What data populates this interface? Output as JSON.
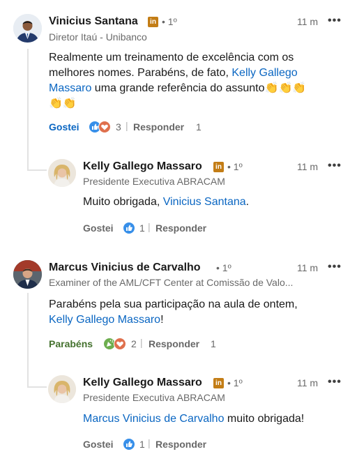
{
  "comments": [
    {
      "author": "Vinicius Santana",
      "badge": "in",
      "degree": "• 1º",
      "headline": "Diretor Itaú - Unibanco",
      "time": "11 m",
      "more": "•••",
      "text_line1": "Realmente um treinamento de excelência com os",
      "text_line2_pre": "melhores nomes.  Parabéns,  de fato, ",
      "text_line2_mention": "Kelly Gallego",
      "text_line3_mention": "Massaro",
      "text_line3_post": " uma grande referência do assunto",
      "emoji": "👏👏👏",
      "emoji2": "👏👏",
      "reaction_label": "Gostei",
      "reaction_count": "3",
      "reply_label": "Responder",
      "reply_count": "1"
    },
    {
      "author": "Kelly Gallego Massaro",
      "badge": "in",
      "degree": "• 1º",
      "headline": "Presidente Executiva ABRACAM",
      "time": "11 m",
      "more": "•••",
      "text_pre": "Muito obrigada, ",
      "text_mention": "Vinicius Santana",
      "text_post": ".",
      "reaction_label": "Gostei",
      "reaction_count": "1",
      "reply_label": "Responder"
    },
    {
      "author": "Marcus Vinicius de Carvalho",
      "degree": "• 1º",
      "headline": "Examiner of the AML/CFT Center at Comissão de Valo...",
      "time": "11 m",
      "more": "•••",
      "text_line1": "Parabéns pela sua participação na aula de ontem,",
      "text_line2_mention": "Kelly Gallego Massaro",
      "text_line2_post": "!",
      "reaction_label": "Parabéns",
      "reaction_count": "2",
      "reply_label": "Responder",
      "reply_count": "1"
    },
    {
      "author": "Kelly Gallego Massaro",
      "badge": "in",
      "degree": "• 1º",
      "headline": "Presidente Executiva ABRACAM",
      "time": "11 m",
      "more": "•••",
      "text_mention": "Marcus Vinicius de Carvalho",
      "text_post": " muito obrigada!",
      "reaction_label": "Gostei",
      "reaction_count": "1",
      "reply_label": "Responder"
    }
  ],
  "colors": {
    "link": "#0a66c2",
    "premium_badge": "#c37d16",
    "celebrate": "#44712e",
    "like": "#378fe9",
    "love": "#df704d"
  }
}
